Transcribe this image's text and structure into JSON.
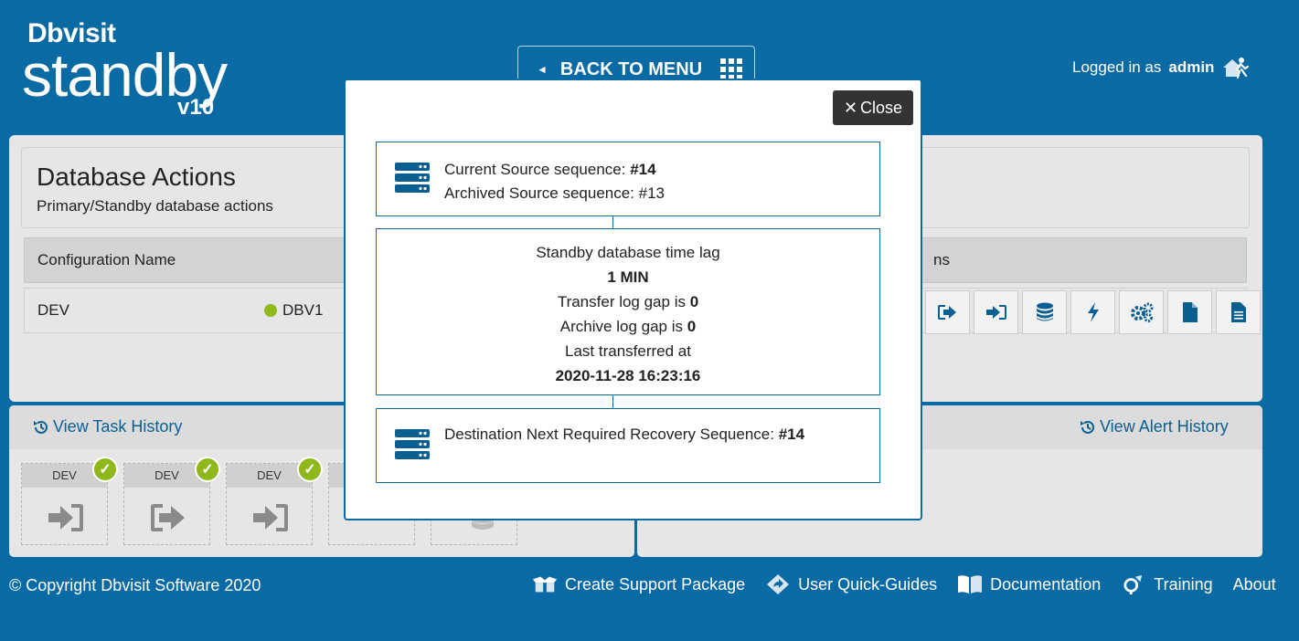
{
  "header": {
    "brand": "Dbvisit",
    "product": "standby",
    "version": "v10",
    "back_to_menu": "BACK TO MENU",
    "logged_in_prefix": "Logged in as",
    "logged_in_user": "admin"
  },
  "main": {
    "title": "Database Actions",
    "subtitle": "Primary/Standby database actions",
    "col_configuration": "Configuration Name",
    "col_actions_partial": "ns",
    "row": {
      "name": "DEV",
      "database": "DBV1",
      "status_color": "#8fb81d"
    },
    "action_icons": [
      "switch-out-icon",
      "switch-in-icon",
      "database-icon",
      "lightning-icon",
      "gears-icon",
      "file-icon",
      "document-icon"
    ]
  },
  "task_history": {
    "link": "View Task History",
    "tiles": [
      {
        "label": "DEV",
        "icon": "arrow-in-icon",
        "done": true
      },
      {
        "label": "DEV",
        "icon": "arrow-out-icon",
        "done": true
      },
      {
        "label": "DEV",
        "icon": "arrow-in-icon",
        "done": true
      }
    ]
  },
  "alert_history": {
    "link": "View Alert History"
  },
  "modal": {
    "close_label": "Close",
    "source_current_label": "Current Source sequence:",
    "source_current_value": "#14",
    "source_archived_label": "Archived Source sequence:",
    "source_archived_value": "#13",
    "lag_label": "Standby database time lag",
    "lag_value": "1 MIN",
    "transfer_gap_label": "Transfer log gap is",
    "transfer_gap_value": "0",
    "archive_gap_label": "Archive log gap is",
    "archive_gap_value": "0",
    "last_transferred_label": "Last transferred at",
    "last_transferred_value": "2020-11-28 16:23:16",
    "dest_label": "Destination Next Required Recovery Sequence:",
    "dest_value": "#14"
  },
  "footer": {
    "copyright": "© Copyright Dbvisit Software 2020",
    "support": "Create Support Package",
    "guides": "User Quick-Guides",
    "docs": "Documentation",
    "training": "Training",
    "about": "About"
  },
  "colors": {
    "background": "#0a6aa3",
    "accent": "#0a5f92",
    "ok": "#8fb81d"
  }
}
